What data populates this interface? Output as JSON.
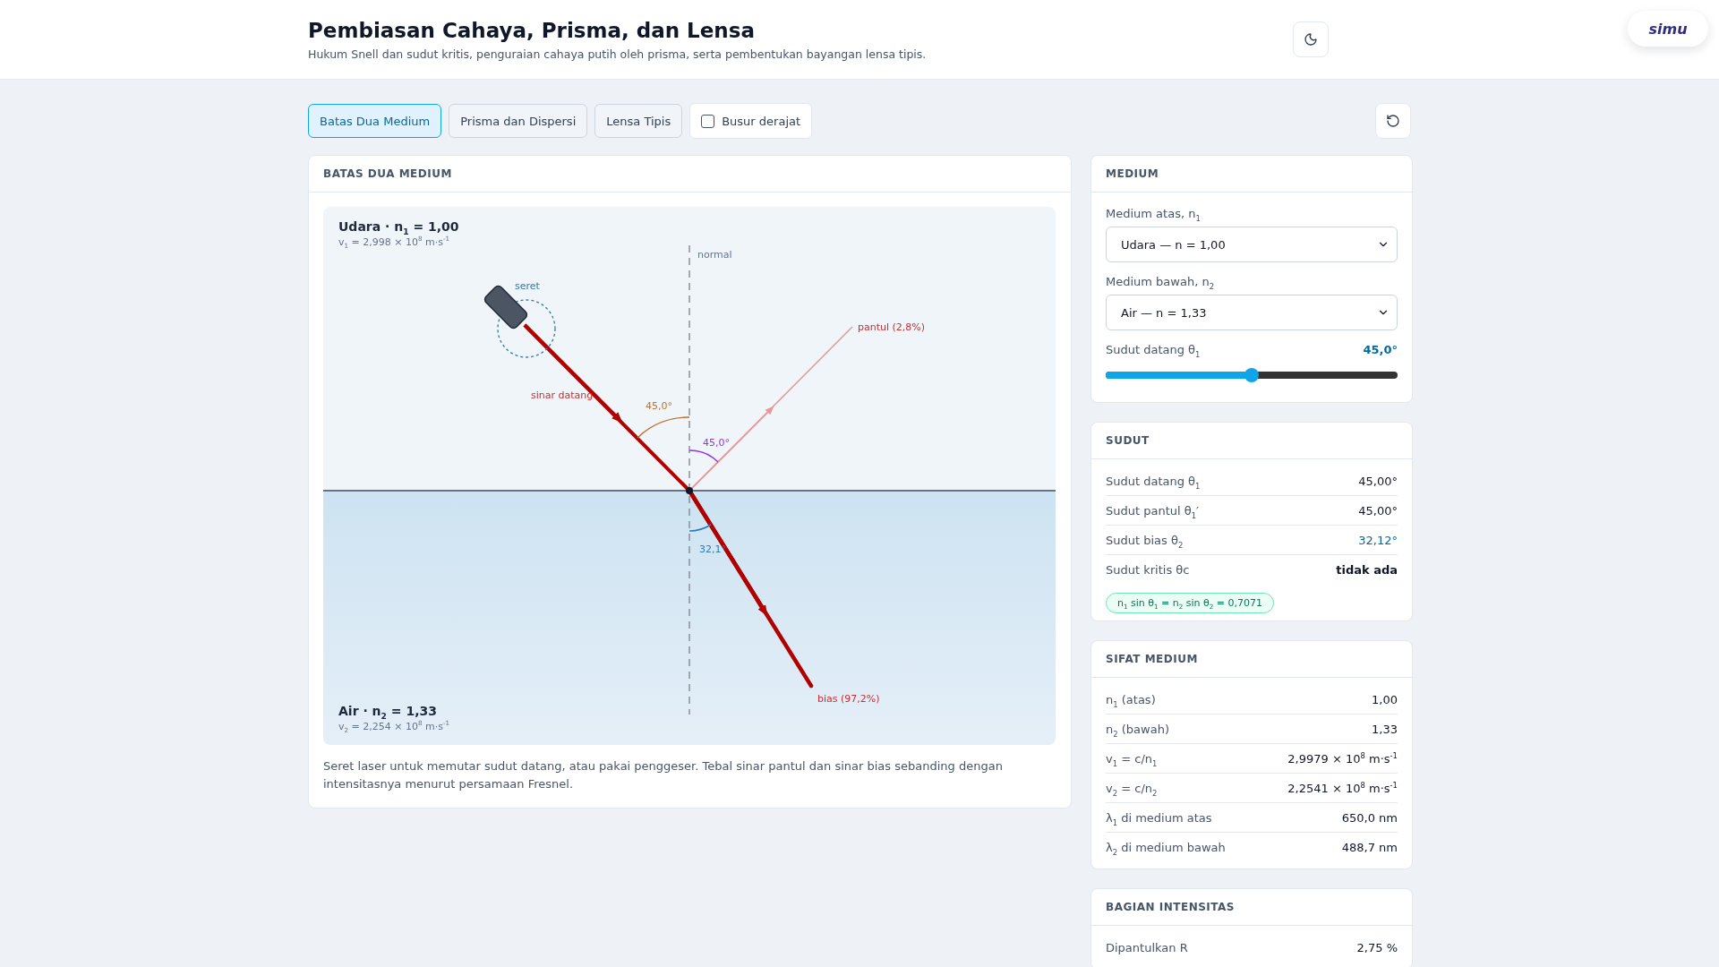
{
  "header": {
    "title": "Pembiasan Cahaya, Prisma, dan Lensa",
    "subtitle": "Hukum Snell dan sudut kritis, penguraian cahaya putih oleh prisma, serta pembentukan bayangan lensa tipis.",
    "logo": "simu"
  },
  "tabs": [
    {
      "label": "Batas Dua Medium",
      "selected": true
    },
    {
      "label": "Prisma dan Dispersi",
      "selected": false
    },
    {
      "label": "Lensa Tipis",
      "selected": false
    }
  ],
  "protractor": {
    "label": "Busur derajat",
    "checked": false
  },
  "diagram_card": {
    "title": "BATAS DUA MEDIUM",
    "upper": {
      "name": "Udara · n$_{1}$ = 1,00",
      "speed": "v$_{1}$ = 2,998 × 10$^{8}$ m·s$^{-1}$"
    },
    "lower": {
      "name": "Air · n$_{2}$ = 1,33",
      "speed": "v$_{2}$ = 2,254 × 10$^{8}$ m·s$^{-1}$"
    },
    "labels": {
      "normal": "normal",
      "handle": "seret",
      "incident": "sinar datang",
      "reflected": "pantul (2,8%)",
      "refracted": "bias (97,2%)",
      "incident_angle": "45,0°",
      "reflected_angle": "45,0°",
      "refracted_angle": "32,1°"
    },
    "caption": "Seret laser untuk memutar sudut datang, atau pakai penggeser. Tebal sinar pantul dan sinar bias sebanding dengan intensitasnya menurut persamaan Fresnel."
  },
  "medium_panel": {
    "title": "MEDIUM",
    "upper_label": "Medium atas, n$_{1}$",
    "upper_value": "Udara — n = 1,00",
    "lower_label": "Medium bawah, n$_{2}$",
    "lower_value": "Air — n = 1,33",
    "angle_label": "Sudut datang θ$_{1}$",
    "angle_value": "45,0°",
    "level": 0.5
  },
  "panels": [
    {
      "title": "SUDUT",
      "rows": [
        {
          "label": "Sudut datang θ$_{1}$",
          "value": "45,00°",
          "kind": "plain"
        },
        {
          "label": "Sudut pantul θ$_{1}$′",
          "value": "45,00°",
          "kind": "plain"
        },
        {
          "label": "Sudut bias θ$_{2}$",
          "value": "32,12°",
          "kind": "accent"
        },
        {
          "label": "Sudut kritis θc",
          "value": "tidak ada",
          "kind": "strong"
        }
      ],
      "formula": "n$_{1}$ sin θ$_{1}$ = n$_{2}$ sin θ$_{2}$ = 0,7071"
    },
    {
      "title": "SIFAT MEDIUM",
      "rows": [
        {
          "label": "n$_{1}$ (atas)",
          "value": "1,00",
          "kind": "plain"
        },
        {
          "label": "n$_{2}$ (bawah)",
          "value": "1,33",
          "kind": "plain"
        },
        {
          "label": "v$_{1}$ = c/n$_{1}$",
          "value": "2,9979 × 10$^{8}$ m·s$^{-1}$",
          "kind": "plain"
        },
        {
          "label": "v$_{2}$ = c/n$_{2}$",
          "value": "2,2541 × 10$^{8}$ m·s$^{-1}$",
          "kind": "plain"
        },
        {
          "label": "λ$_{1}$ di medium atas",
          "value": "650,0 nm",
          "kind": "plain"
        },
        {
          "label": "λ$_{2}$ di medium bawah",
          "value": "488,7 nm",
          "kind": "plain"
        }
      ]
    },
    {
      "title": "BAGIAN INTENSITAS",
      "rows": [
        {
          "label": "Dipantulkan R",
          "value": "2,75 %",
          "kind": "plain"
        }
      ]
    }
  ]
}
